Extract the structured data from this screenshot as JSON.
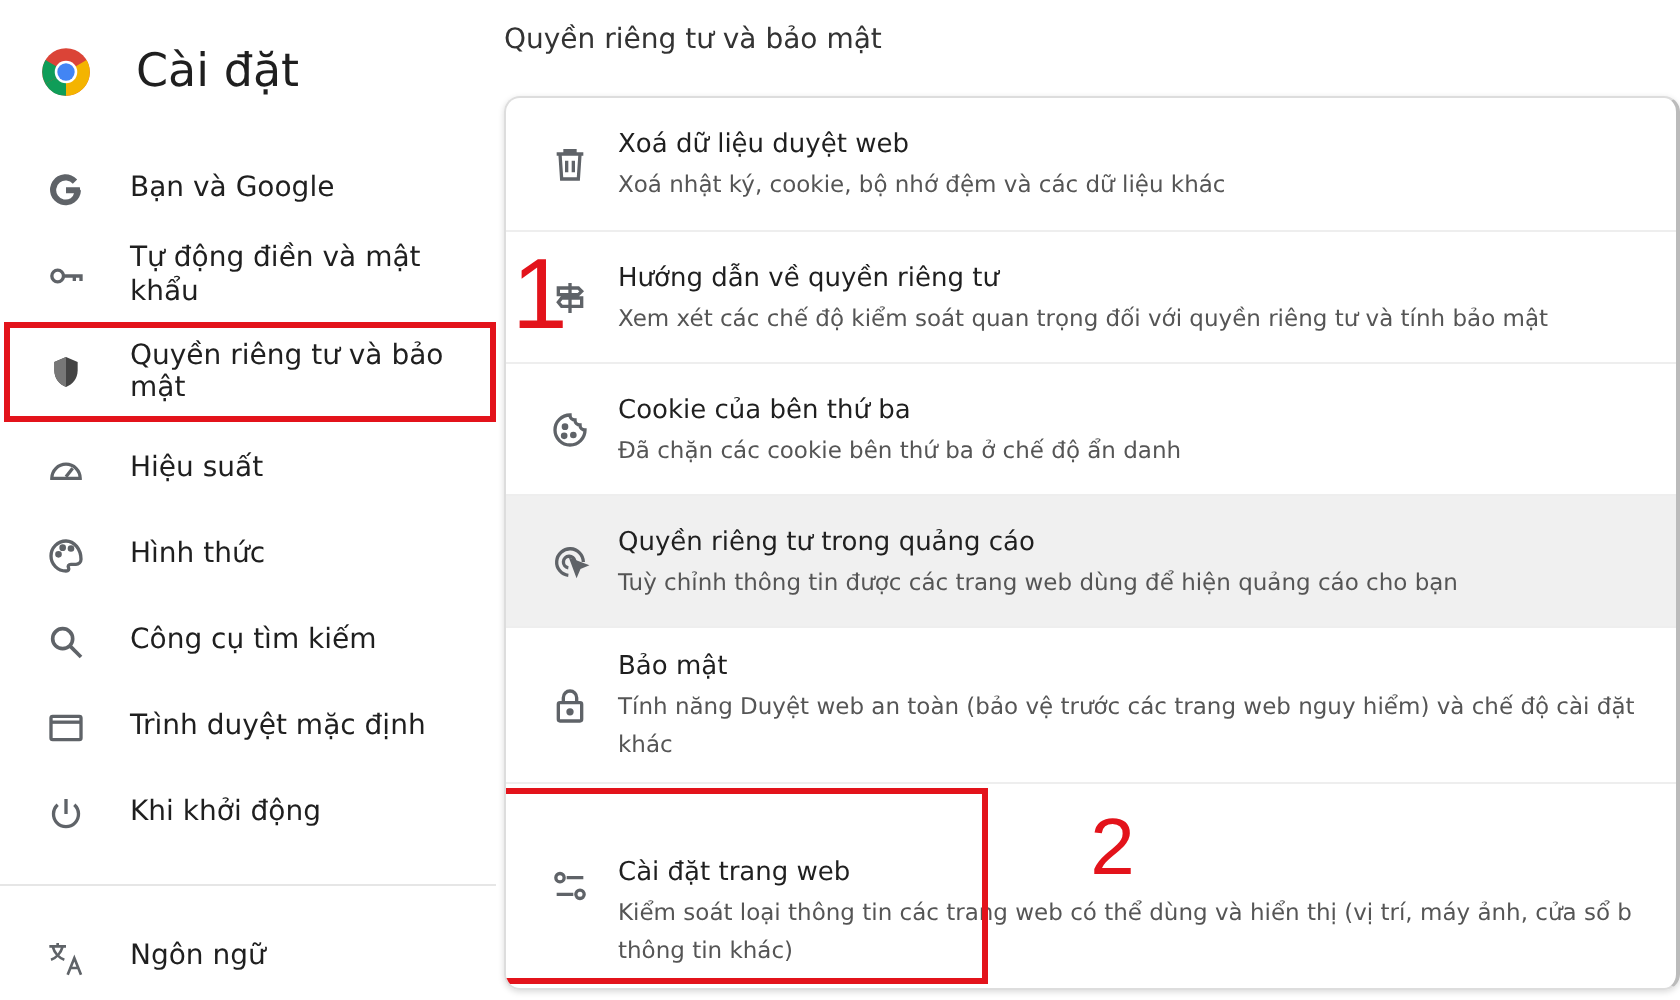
{
  "app": {
    "title": "Cài đặt"
  },
  "sidebar": {
    "items": [
      {
        "label": "Bạn và Google",
        "callout": false
      },
      {
        "label": "Tự động điền và mật khẩu",
        "callout": false
      },
      {
        "label": "Quyền riêng tư và bảo mật",
        "callout": true
      },
      {
        "label": "Hiệu suất",
        "callout": false
      },
      {
        "label": "Hình thức",
        "callout": false
      },
      {
        "label": "Công cụ tìm kiếm",
        "callout": false
      },
      {
        "label": "Trình duyệt mặc định",
        "callout": false
      },
      {
        "label": "Khi khởi động",
        "callout": false
      }
    ],
    "more_items": [
      {
        "label": "Ngôn ngữ"
      }
    ]
  },
  "section": {
    "title": "Quyền riêng tư và bảo mật",
    "rows": [
      {
        "title": "Xoá dữ liệu duyệt web",
        "description": [
          "Xoá nhật ký, cookie, bộ nhớ đệm và các dữ liệu khác"
        ],
        "hovered": false,
        "callout": false
      },
      {
        "title": "Hướng dẫn về quyền riêng tư",
        "description": [
          "Xem xét các chế độ kiểm soát quan trọng đối với quyền riêng tư và tính bảo mật"
        ],
        "hovered": false,
        "callout": false,
        "step": "1"
      },
      {
        "title": "Cookie của bên thứ ba",
        "description": [
          "Đã chặn các cookie bên thứ ba ở chế độ ẩn danh"
        ],
        "hovered": false,
        "callout": false
      },
      {
        "title": "Quyền riêng tư trong quảng cáo",
        "description": [
          "Tuỳ chỉnh thông tin được các trang web dùng để hiện quảng cáo cho bạn"
        ],
        "hovered": true,
        "callout": false
      },
      {
        "title": "Bảo mật",
        "description": [
          "Tính năng Duyệt web an toàn (bảo vệ trước các trang web nguy hiểm) và chế độ cài đặt",
          "khác"
        ],
        "hovered": false,
        "callout": false
      },
      {
        "title": "Cài đặt trang web",
        "description": [
          "Kiểm soát loại thông tin các trang web có thể dùng và hiển thị (vị trí, máy ảnh, cửa sổ b",
          "thông tin khác)"
        ],
        "hovered": false,
        "callout": true,
        "step": "2"
      }
    ]
  }
}
